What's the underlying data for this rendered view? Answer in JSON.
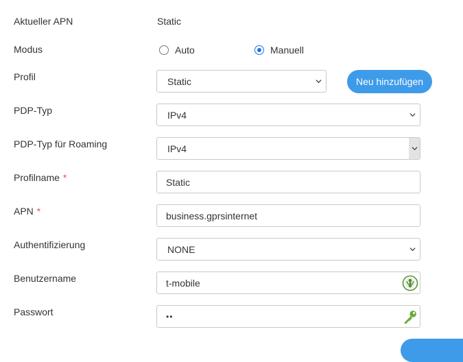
{
  "labels": {
    "current_apn": "Aktueller APN",
    "mode": "Modus",
    "profile": "Profil",
    "pdp_type": "PDP-Typ",
    "pdp_type_roaming": "PDP-Typ für Roaming",
    "profile_name": "Profilname",
    "apn": "APN",
    "authentication": "Authentifizierung",
    "username": "Benutzername",
    "password": "Passwort",
    "required_mark": "*"
  },
  "current_apn_value": "Static",
  "mode": {
    "options": [
      "Auto",
      "Manuell"
    ],
    "selected": "Manuell"
  },
  "profile": {
    "selected": "Static",
    "add_button": "Neu hinzufügen"
  },
  "pdp_type": {
    "selected": "IPv4"
  },
  "pdp_type_roaming": {
    "selected": "IPv4"
  },
  "profile_name": {
    "value": "Static"
  },
  "apn": {
    "value": "business.gprsinternet"
  },
  "authentication": {
    "selected": "NONE"
  },
  "username": {
    "value": "t-mobile",
    "icon": "password-manager-icon"
  },
  "password": {
    "value": "••",
    "icon": "key-icon"
  },
  "colors": {
    "accent": "#3e9be9",
    "required": "#e5534b",
    "radio_checked": "#1a73e8",
    "key_icon": "#6aab3c"
  }
}
